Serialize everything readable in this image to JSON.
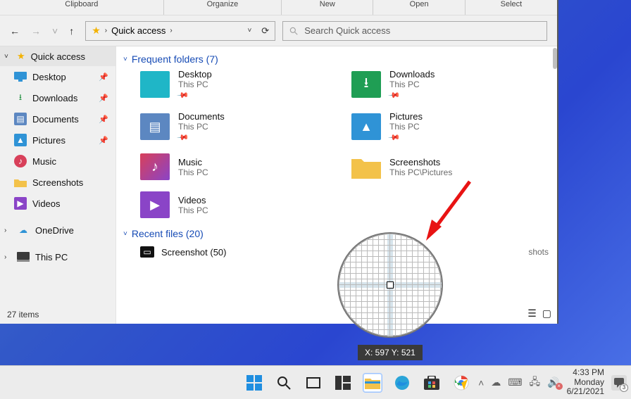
{
  "ribbon": {
    "labels": [
      "Clipboard",
      "Organize",
      "New",
      "Open",
      "Select"
    ]
  },
  "address": {
    "crumb": "Quick access",
    "search_placeholder": "Search Quick access"
  },
  "sidebar": {
    "top": "Quick access",
    "items": [
      {
        "label": "Desktop"
      },
      {
        "label": "Downloads"
      },
      {
        "label": "Documents"
      },
      {
        "label": "Pictures"
      },
      {
        "label": "Music"
      },
      {
        "label": "Screenshots"
      },
      {
        "label": "Videos"
      }
    ],
    "lower": [
      {
        "label": "OneDrive"
      },
      {
        "label": "This PC"
      }
    ]
  },
  "status": {
    "items": "27 items"
  },
  "frequent": {
    "header": "Frequent folders (7)",
    "folders": [
      {
        "name": "Desktop",
        "sub": "This PC",
        "pinned": true
      },
      {
        "name": "Downloads",
        "sub": "This PC",
        "pinned": true
      },
      {
        "name": "Documents",
        "sub": "This PC",
        "pinned": true
      },
      {
        "name": "Pictures",
        "sub": "This PC",
        "pinned": true
      },
      {
        "name": "Music",
        "sub": "This PC",
        "pinned": false
      },
      {
        "name": "Screenshots",
        "sub": "This PC\\Pictures",
        "pinned": false
      },
      {
        "name": "Videos",
        "sub": "This PC",
        "pinned": false
      }
    ]
  },
  "recent": {
    "header": "Recent files (20)",
    "items": [
      {
        "name": "Screenshot (50)",
        "location": "shots"
      }
    ]
  },
  "magnifier": {
    "coords_label": "X: 597 Y: 521"
  },
  "taskbar": {
    "time": "4:33 PM",
    "day": "Monday",
    "date": "6/21/2021",
    "notif_count": "3"
  }
}
